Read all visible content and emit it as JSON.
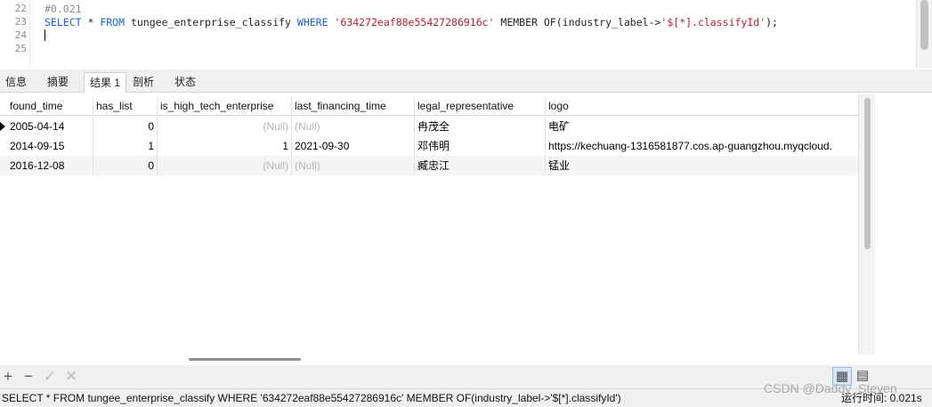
{
  "editor": {
    "lines": [
      {
        "number": "22",
        "parts": [
          {
            "text": "#0.021",
            "class": "cm"
          }
        ]
      },
      {
        "number": "23",
        "parts": [
          {
            "text": "SELECT",
            "class": "kw"
          },
          {
            "text": " * ",
            "class": ""
          },
          {
            "text": "FROM",
            "class": "kw"
          },
          {
            "text": " tungee_enterprise_classify ",
            "class": ""
          },
          {
            "text": "WHERE",
            "class": "kw"
          },
          {
            "text": " ",
            "class": ""
          },
          {
            "text": "'634272eaf88e55427286916c'",
            "class": "str"
          },
          {
            "text": " MEMBER OF(industry_label->",
            "class": ""
          },
          {
            "text": "'$[*].classifyId'",
            "class": "str"
          },
          {
            "text": ");",
            "class": ""
          }
        ]
      },
      {
        "number": "24",
        "parts": []
      },
      {
        "number": "25",
        "parts": []
      }
    ]
  },
  "tabs": [
    "信息",
    "摘要",
    "结果 1",
    "剖析",
    "状态"
  ],
  "active_tab": "结果 1",
  "grid": {
    "columns": [
      "found_time",
      "has_list",
      "is_high_tech_enterprise",
      "last_financing_time",
      "legal_representative",
      "logo"
    ],
    "rows": [
      [
        "2005-04-14",
        "0",
        "(Null)",
        "(Null)",
        "冉茂全",
        "电矿"
      ],
      [
        "2014-09-15",
        "1",
        "1",
        "2021-09-30",
        "邓伟明",
        "https://kechuang-1316581877.cos.ap-guangzhou.myqcloud."
      ],
      [
        "2016-12-08",
        "0",
        "(Null)",
        "(Null)",
        "臧忠江",
        "锰业"
      ]
    ]
  },
  "toolbar": {
    "add": "+",
    "remove": "−",
    "apply": "✓",
    "discard": "✕",
    "grid_view": "▦",
    "form_view": "▤"
  },
  "status": {
    "sql": "SELECT * FROM tungee_enterprise_classify WHERE '634272eaf88e55427286916c' MEMBER OF(industry_label->'$[*].classifyId')",
    "time": "运行时间: 0.021s"
  },
  "watermark": "CSDN @Daddy_Steven"
}
